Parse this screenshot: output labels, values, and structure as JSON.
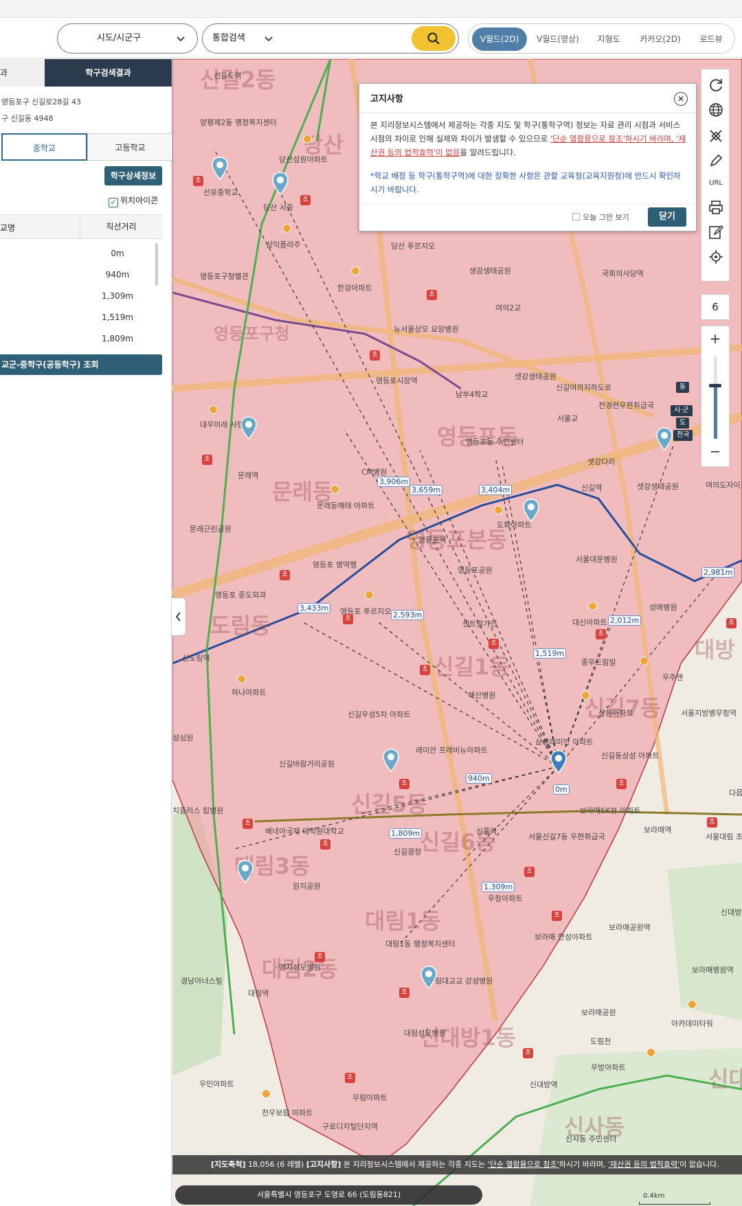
{
  "topbar": {
    "region_select": "시도/시군구",
    "search_type": "통합검색",
    "search_value": "",
    "modes": [
      {
        "label": "V월드(2D)",
        "active": true
      },
      {
        "label": "V월드(영상)",
        "active": false
      },
      {
        "label": "지형도",
        "active": false
      },
      {
        "label": "카카오(2D)",
        "active": false
      },
      {
        "label": "로드뷰",
        "active": false
      }
    ]
  },
  "panel": {
    "tab_left": "과",
    "tab_right": "학구검색결과",
    "address_road": "영등포구 신길로28길 43",
    "address_lot": "구 신길동 4948",
    "school_tabs": [
      "중학교",
      "고등학교"
    ],
    "detail_button": "학구상세정보",
    "location_icon_label": "위치아이콘",
    "columns": [
      "교명",
      "직선거리"
    ],
    "rows": [
      "0m",
      "940m",
      "1,309m",
      "1,519m",
      "1,809m"
    ],
    "share_button": "교군-중학구(공동학구) 조회"
  },
  "notice": {
    "title": "고지사항",
    "body_1": "본 지리정보시스템에서 제공하는 각종 지도 및 학구(통학구역) 정보는 자료 관리 시점과 서비스 시점의 차이로 인해 실제와 차이가 발생할 수 있으므로 ",
    "body_red_1": "'단순 열람용으로 참조'하시기 바라며, '재산권 등의 법적효력'이 없음",
    "body_2": "을 알려드립니다.",
    "body_blue": "*학교 배정 등 학구(통학구역)에 대한 정확한 사항은 관할 교육청(교육지원청)에 반드시 확인하시기 바랍니다.",
    "today_label": "오늘 그만 보기",
    "close_button": "닫기"
  },
  "map_controls": {
    "url_label": "URL",
    "level": "6",
    "zoom_in": "+",
    "zoom_out": "−",
    "zoom_level_fraction": 0.35,
    "zoom_labels": [
      "동",
      "시·군",
      "도",
      "전국"
    ]
  },
  "map": {
    "district_labels": [
      "신길2동",
      "당산",
      "영등포동",
      "문래동",
      "도림동",
      "신길5동",
      "신길6동",
      "신길7동",
      "대림1동",
      "대림2동",
      "신대방1동",
      "영등포본동",
      "신길1동",
      "대방",
      "신대방",
      "신사동",
      "대림3동",
      "영등포구청"
    ],
    "place_labels": [
      "선유도역",
      "양평제2동 행정복지센터",
      "당산성원아파트",
      "선유중학교",
      "당산 서중",
      "삼익플라주",
      "당산 푸르지오",
      "영등포구청별관",
      "한강아파트",
      "생강생태공원",
      "국회의사당역",
      "여의2교",
      "뉴서울상모 요양병원",
      "영등포시장역",
      "남부4학교",
      "샛강생태공원",
      "신길여의지하도로",
      "전경련우편취급국",
      "서울교",
      "영등포동 주민센터",
      "대우미래 사랑3차",
      "CM병원",
      "문래역",
      "문래등해태 아파트",
      "샛강다리",
      "신길역",
      "샛강생태공원",
      "여의도자이",
      "영등포역",
      "문래근린공원",
      "도화아파트",
      "영등포 영역행",
      "영등포공원",
      "서울대운병원",
      "영등포 중도외과",
      "영등포 푸르지오",
      "센트럴가인",
      "대신아파트",
      "성애병원",
      "신도림역",
      "해산병원",
      "종우드림빌",
      "우주맨",
      "하나아파트",
      "신길우성5차 아파트",
      "삼환아파트",
      "서울지방병무청역",
      "신길바람거리공원",
      "래미안 프레비뉴아파트",
      "삼성래미안 아파트",
      "신길동삼성 아파트",
      "베네아국제 대학원대학교",
      "신풍역",
      "보라매SK뷰 아파트",
      "보라매역",
      "서울신길7동 우편취급국",
      "서울대림 초등학교",
      "신길광장",
      "원지공원",
      "우창아파트",
      "신대방",
      "보라매공원역",
      "보라매 한성아파트",
      "대림1동 행정복지센터",
      "명지성모병원",
      "경남아너스빌",
      "대림역",
      "림대교교 강성병원",
      "보라매병원역",
      "보라매공원",
      "아카데미타워",
      "대림성모병원",
      "도림천",
      "우방아파트",
      "신대방역",
      "우민아파트",
      "무림아파트",
      "천우보람 아파트",
      "구로디지털단지역",
      "신사동 주민센터",
      "치들러스 립병원",
      "성심원",
      "다음"
    ],
    "distance_labels": [
      "3,906m",
      "3,659m",
      "3,404m",
      "3,433m",
      "2,593m",
      "2,981m",
      "2,012m",
      "1,519m",
      "940m",
      "0m",
      "1,809m",
      "1,309m"
    ],
    "address_bar": "서울특별시 영등포구 도영로 66 (도림동821)",
    "scale_label": "0.4km",
    "footer_scale_head": "[지도축척]",
    "footer_scale_value": " 18,056 (6 레벨) ",
    "footer_notice_head": "[고지사항]",
    "footer_notice_1": " 본 지리정보시스템에서 제공하는 각종 지도는 ",
    "footer_notice_link_1": "'단순 열람용으로 참조'",
    "footer_notice_2": "하시기 바라며, ",
    "footer_notice_link_2": "'재산권 등의 법적효력'",
    "footer_notice_3": "이 없습니다."
  },
  "colors": {
    "accent": "#4f7ea8",
    "panel_header": "#2c3a4e",
    "button": "#2f5f77",
    "search_button": "#f2c230",
    "school_zone_fill": "#f3a3a9",
    "distance_text": "#1d4f9c",
    "school_marker": "#d9413d"
  }
}
